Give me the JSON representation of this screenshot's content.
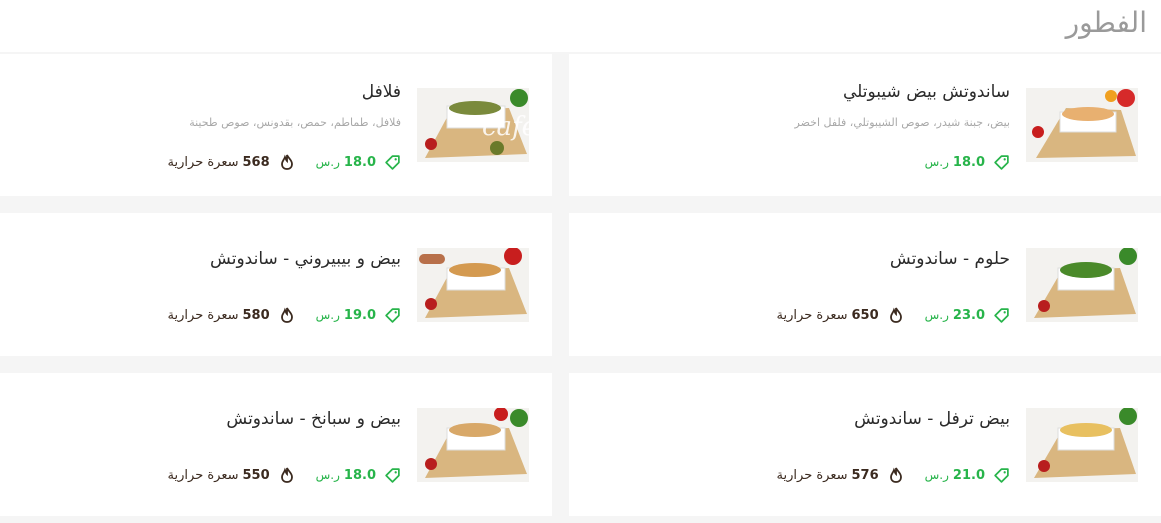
{
  "section": {
    "title": "الفطور"
  },
  "currency_label": "ر.س",
  "calories_label": "سعرة حرارية",
  "colors": {
    "price": "#27b44a",
    "calories": "#3b2a1f",
    "card_bg": "#ffffff",
    "page_bg": "#f5f5f5"
  },
  "items": [
    {
      "title": "ساندوتش بيض شيبوتلي",
      "description": "بيض، جبنة شيدر، صوص الشيبوتلي، فلفل اخضر",
      "price": "18.0",
      "calories": ""
    },
    {
      "title": "فلافل",
      "description": "فلافل، طماطم، حمص، بقدونس، صوص طحينة",
      "price": "18.0",
      "calories": "568"
    },
    {
      "title": "حلوم - ساندوتش",
      "description": "",
      "price": "23.0",
      "calories": "650"
    },
    {
      "title": "بيض و بيبيروني - ساندوتش",
      "description": "",
      "price": "19.0",
      "calories": "580"
    },
    {
      "title": "بيض ترفل - ساندوتش",
      "description": "",
      "price": "21.0",
      "calories": "576"
    },
    {
      "title": "بيض و سبانخ - ساندوتش",
      "description": "",
      "price": "18.0",
      "calories": "550"
    }
  ],
  "icons": {
    "price": "price-tag-icon",
    "calories": "fire-icon"
  }
}
